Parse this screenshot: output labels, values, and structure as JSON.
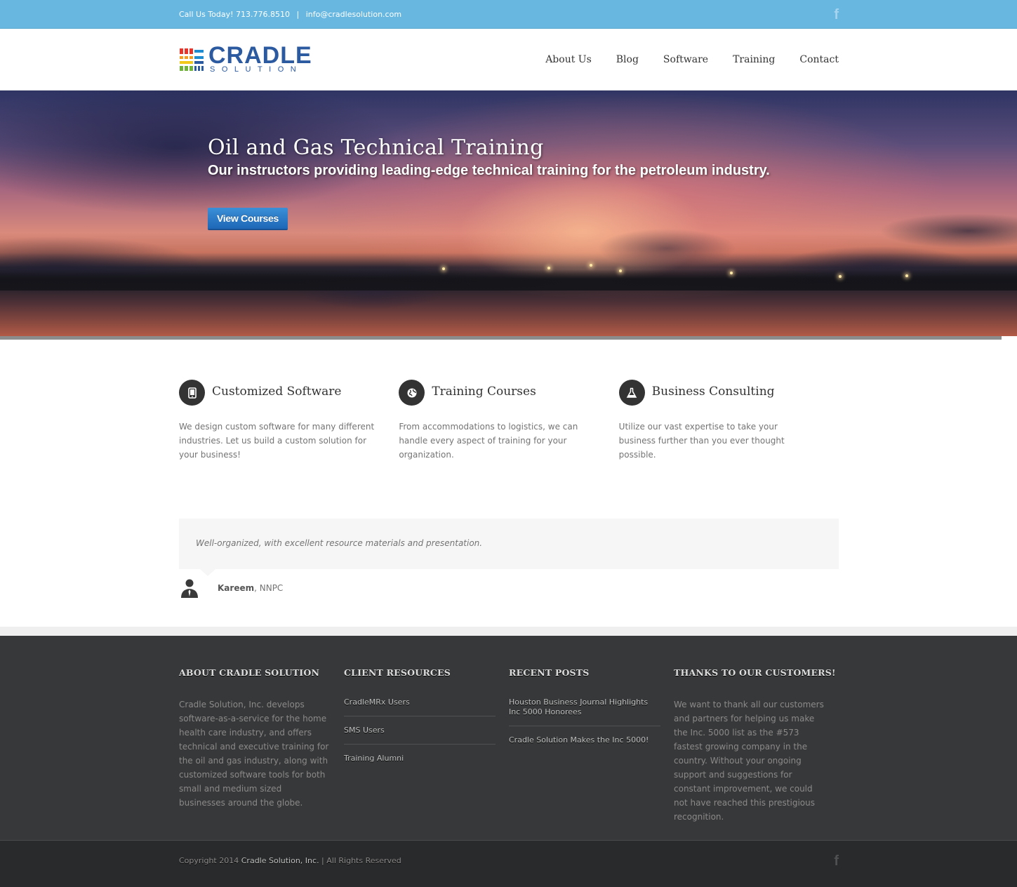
{
  "topbar": {
    "phone_text": "Call Us Today! 713.776.8510",
    "separator": "|",
    "email": "info@cradlesolution.com",
    "social_icon": "facebook-icon",
    "social_glyph": "f"
  },
  "header": {
    "logo_word": "CRADLE",
    "logo_sub": "SOLUTION",
    "nav": [
      "About Us",
      "Blog",
      "Software",
      "Training",
      "Contact"
    ]
  },
  "hero": {
    "title": "Oil and Gas Technical Training",
    "subtitle": "Our instructors providing leading-edge technical training for the petroleum industry.",
    "button": "View Courses"
  },
  "features": [
    {
      "icon": "tablet-icon",
      "title": "Customized Software",
      "text": "We design custom software for many different industries. Let us build a custom solution for your business!"
    },
    {
      "icon": "globe-icon",
      "title": "Training Courses",
      "text": "From accommodations to logistics, we can handle every aspect of training for your organization."
    },
    {
      "icon": "flask-icon",
      "title": "Business Consulting",
      "text": "Utilize our vast expertise to take your business further than you ever thought possible."
    }
  ],
  "testimonial": {
    "quote": "Well-organized, with excellent resource materials and presentation.",
    "author_name": "Kareem",
    "author_org": ", NNPC"
  },
  "footer": {
    "about": {
      "heading": "ABOUT CRADLE SOLUTION",
      "text": "Cradle Solution, Inc. develops software-as-a-service for the home health care industry, and offers technical and executive training for the oil and gas industry, along with customized software tools for both small and medium sized businesses around the globe."
    },
    "resources": {
      "heading": "CLIENT RESOURCES",
      "links": [
        "CradleMRx Users",
        "SMS Users",
        "Training Alumni"
      ]
    },
    "posts": {
      "heading": "RECENT POSTS",
      "links": [
        "Houston Business Journal Highlights Inc 5000 Honorees",
        "Cradle Solution Makes the Inc 5000!"
      ]
    },
    "thanks": {
      "heading": "THANKS TO OUR CUSTOMERS!",
      "text": "We want to thank all our customers and partners for helping us make the Inc. 5000 list as the #573 fastest growing company in the country. Without your ongoing support and suggestions for constant improvement, we could not have reached this prestigious recognition."
    },
    "copyright_prefix": "Copyright 2014 ",
    "copyright_company": "Cradle Solution, Inc.",
    "copyright_suffix": " | All Rights Reserved"
  },
  "colors": {
    "topbar": "#67b7e1",
    "brand": "#2c5aa0",
    "button": "#1e67b7",
    "footer": "#363839"
  }
}
